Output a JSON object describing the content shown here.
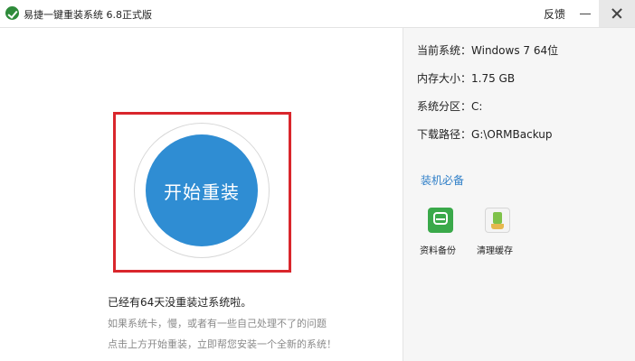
{
  "window": {
    "title": "易捷一键重装系统 6.8正式版",
    "feedback": "反馈",
    "icons": {
      "logo": "leaf-logo-icon",
      "minimize": "minimize-icon",
      "close": "close-icon"
    }
  },
  "main": {
    "start_button_label": "开始重装",
    "status_text": "已经有64天没重装过系统啦。",
    "hint_line1": "如果系统卡，慢，或者有一些自己处理不了的问题",
    "hint_line2": "点击上方开始重装，立即帮您安装一个全新的系统！"
  },
  "system_info": {
    "os_label": "当前系统：",
    "os_value": "Windows 7 64位",
    "mem_label": "内存大小：",
    "mem_value": "1.75 GB",
    "partition_label": "系统分区：",
    "partition_value": "C:",
    "path_label": "下载路径：",
    "path_value": "G:\\ORMBackup"
  },
  "tools": {
    "section_title": "装机必备",
    "items": [
      {
        "label": "资料备份",
        "icon": "backup-icon"
      },
      {
        "label": "清理缓存",
        "icon": "clean-icon"
      }
    ]
  },
  "colors": {
    "accent": "#2f8dd3",
    "highlight": "#d9262c",
    "section_title": "#2f7fc8",
    "logo": "#2e8b3a"
  }
}
